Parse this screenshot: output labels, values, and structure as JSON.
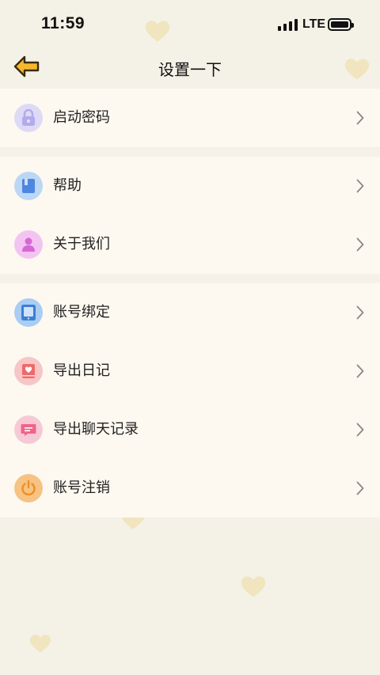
{
  "status_bar": {
    "time": "11:59",
    "network": "LTE"
  },
  "nav": {
    "title": "设置一下",
    "back_icon": "arrow-left-icon"
  },
  "sections": [
    {
      "items": [
        {
          "label": "启动密码",
          "icon": "lock-icon",
          "color": "#b9b2ef"
        }
      ]
    },
    {
      "items": [
        {
          "label": "帮助",
          "icon": "book-icon",
          "color": "#4e86e0"
        },
        {
          "label": "关于我们",
          "icon": "person-icon",
          "color": "#d667d6"
        }
      ]
    },
    {
      "items": [
        {
          "label": "账号绑定",
          "icon": "tablet-icon",
          "color": "#3d7ed6"
        },
        {
          "label": "导出日记",
          "icon": "diary-heart-icon",
          "color": "#ef6a6a"
        },
        {
          "label": "导出聊天记录",
          "icon": "chat-bubble-icon",
          "color": "#f0648a"
        },
        {
          "label": "账号注销",
          "icon": "power-icon",
          "color": "#f08f1e"
        }
      ]
    }
  ],
  "colors": {
    "background": "#f4f1e6",
    "row_background": "#fdf9f0",
    "accent_back_arrow": "#f5b82e"
  }
}
